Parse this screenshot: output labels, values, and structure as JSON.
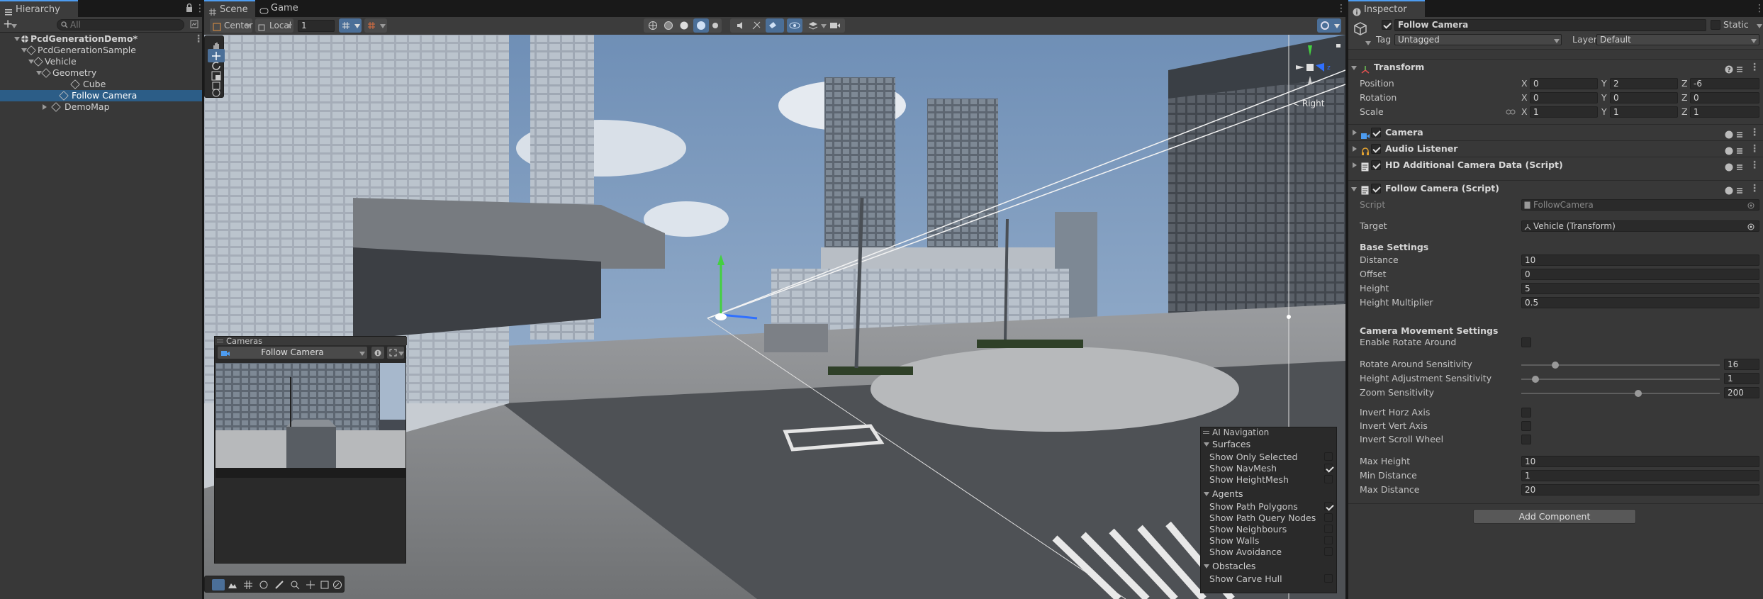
{
  "hierarchy": {
    "tab": "Hierarchy",
    "search_placeholder": "All",
    "add_label": "+",
    "items": [
      {
        "label": "PcdGenerationDemo*"
      },
      {
        "label": "PcdGenerationSample"
      },
      {
        "label": "Vehicle"
      },
      {
        "label": "Geometry"
      },
      {
        "label": "Cube"
      },
      {
        "label": "Follow Camera"
      },
      {
        "label": "DemoMap"
      }
    ]
  },
  "scene": {
    "tabs": [
      {
        "label": "Scene"
      },
      {
        "label": "Game"
      }
    ],
    "pivot": "Center",
    "space": "Local",
    "snap_value": "1",
    "gizmo_label": "< Right",
    "cameras_overlay": {
      "title": "Cameras",
      "selected": "Follow Camera"
    },
    "ai_navigation": {
      "title": "AI Navigation",
      "sections": [
        {
          "title": "Surfaces",
          "rows": [
            {
              "label": "Show Only Selected",
              "checked": false
            },
            {
              "label": "Show NavMesh",
              "checked": true
            },
            {
              "label": "Show HeightMesh",
              "checked": false
            }
          ]
        },
        {
          "title": "Agents",
          "rows": [
            {
              "label": "Show Path Polygons",
              "checked": true
            },
            {
              "label": "Show Path Query Nodes",
              "checked": false
            },
            {
              "label": "Show Neighbours",
              "checked": false
            },
            {
              "label": "Show Walls",
              "checked": false
            },
            {
              "label": "Show Avoidance",
              "checked": false
            }
          ]
        },
        {
          "title": "Obstacles",
          "rows": [
            {
              "label": "Show Carve Hull",
              "checked": false
            }
          ]
        }
      ]
    }
  },
  "inspector": {
    "tab": "Inspector",
    "object_name": "Follow Camera",
    "static_label": "Static",
    "tag_label": "Tag",
    "tag_value": "Untagged",
    "layer_label": "Layer",
    "layer_value": "Default",
    "transform": {
      "title": "Transform",
      "position_label": "Position",
      "rotation_label": "Rotation",
      "scale_label": "Scale",
      "axis_x": "X",
      "axis_y": "Y",
      "axis_z": "Z",
      "position": {
        "x": "0",
        "y": "2",
        "z": "-6"
      },
      "rotation": {
        "x": "0",
        "y": "0",
        "z": "0"
      },
      "scale": {
        "x": "1",
        "y": "1",
        "z": "1"
      }
    },
    "components": [
      {
        "title": "Camera"
      },
      {
        "title": "Audio Listener"
      },
      {
        "title": "HD Additional Camera Data (Script)"
      },
      {
        "title": "Follow Camera (Script)"
      }
    ],
    "script": {
      "script_label": "Script",
      "script_value": "FollowCamera",
      "target_label": "Target",
      "target_value": "Vehicle (Transform)",
      "base_settings": "Base Settings",
      "distance_label": "Distance",
      "distance": "10",
      "offset_label": "Offset",
      "offset": "0",
      "height_label": "Height",
      "height": "5",
      "height_multiplier_label": "Height Multiplier",
      "height_multiplier": "0.5",
      "movement_settings": "Camera Movement Settings",
      "enable_rotate_label": "Enable Rotate Around",
      "rotate_sens_label": "Rotate Around Sensitivity",
      "rotate_sens": "16",
      "rotate_sens_frac": 0.17,
      "height_adj_label": "Height Adjustment Sensitivity",
      "height_adj": "1",
      "height_adj_frac": 0.07,
      "zoom_sens_label": "Zoom Sensitivity",
      "zoom_sens": "200",
      "zoom_sens_frac": 0.59,
      "invert_horz_label": "Invert Horz Axis",
      "invert_vert_label": "Invert Vert Axis",
      "invert_scroll_label": "Invert Scroll Wheel",
      "max_height_label": "Max Height",
      "max_height": "10",
      "min_distance_label": "Min Distance",
      "min_distance": "1",
      "max_distance_label": "Max Distance",
      "max_distance": "20"
    },
    "add_component": "Add Component"
  },
  "colors": {
    "accent": "#4d9cf0",
    "selection": "#2c5d87",
    "panel": "#383838"
  }
}
